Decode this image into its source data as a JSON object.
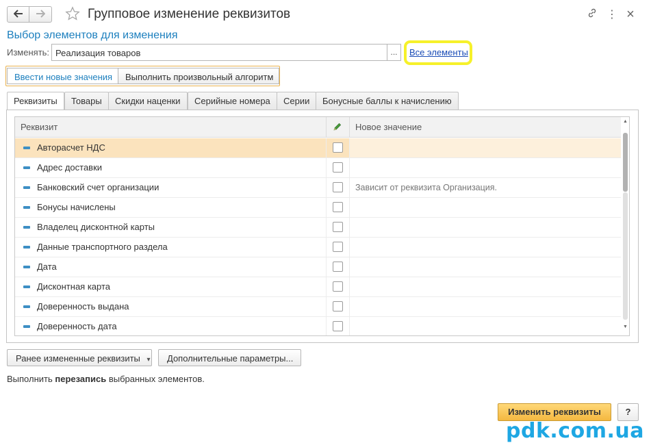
{
  "window": {
    "title": "Групповое изменение реквизитов",
    "back_icon": "arrow-left-icon",
    "forward_icon": "arrow-right-icon",
    "favorite_icon": "star-icon",
    "link_icon": "link-icon",
    "more_icon": "more-vertical-icon",
    "close_icon": "close-icon",
    "close_glyph": "×",
    "more_glyph": "⋮"
  },
  "selection": {
    "section_title": "Выбор элементов для изменения",
    "change_label": "Изменять:",
    "change_value": "Реализация товаров",
    "select_button": "...",
    "all_elements_link": "Все элементы",
    "highlight_color": "#f6f12a"
  },
  "mode_buttons": [
    {
      "label": "Ввести новые значения",
      "active": true
    },
    {
      "label": "Выполнить произвольный алгоритм",
      "active": false
    }
  ],
  "tabs": [
    {
      "label": "Реквизиты",
      "active": true
    },
    {
      "label": "Товары",
      "active": false
    },
    {
      "label": "Скидки наценки",
      "active": false
    },
    {
      "label": "Серийные номера",
      "active": false
    },
    {
      "label": "Серии",
      "active": false
    },
    {
      "label": "Бонусные баллы к начислению",
      "active": false
    }
  ],
  "grid": {
    "columns": {
      "attribute": "Реквизит",
      "edit_icon": "pencil-icon",
      "new_value": "Новое значение"
    },
    "rows": [
      {
        "label": "Авторасчет НДС",
        "checked": false,
        "new_value": "",
        "selected": true
      },
      {
        "label": "Адрес доставки",
        "checked": false,
        "new_value": "",
        "selected": false
      },
      {
        "label": "Банковский счет организации",
        "checked": false,
        "new_value": "Зависит от реквизита Организация.",
        "selected": false
      },
      {
        "label": "Бонусы начислены",
        "checked": false,
        "new_value": "",
        "selected": false
      },
      {
        "label": "Владелец дисконтной карты",
        "checked": false,
        "new_value": "",
        "selected": false
      },
      {
        "label": "Данные транспортного раздела",
        "checked": false,
        "new_value": "",
        "selected": false
      },
      {
        "label": "Дата",
        "checked": false,
        "new_value": "",
        "selected": false
      },
      {
        "label": "Дисконтная карта",
        "checked": false,
        "new_value": "",
        "selected": false
      },
      {
        "label": "Доверенность выдана",
        "checked": false,
        "new_value": "",
        "selected": false
      },
      {
        "label": "Доверенность дата",
        "checked": false,
        "new_value": "",
        "selected": false
      }
    ],
    "selected_row_color": "#fbe3bd",
    "scroll_up_glyph": "▲",
    "scroll_down_glyph": "▼"
  },
  "footer": {
    "previous_button": "Ранее измененные реквизиты",
    "previous_dropdown_glyph": "▾",
    "additional_button": "Дополнительные параметры...",
    "note_before": "Выполнить ",
    "note_bold": "перезапись",
    "note_after": " выбранных элементов.",
    "primary_button": "Изменить реквизиты",
    "help_button": "?",
    "primary_color": "#f4b840"
  },
  "watermark": "pdk.com.ua"
}
